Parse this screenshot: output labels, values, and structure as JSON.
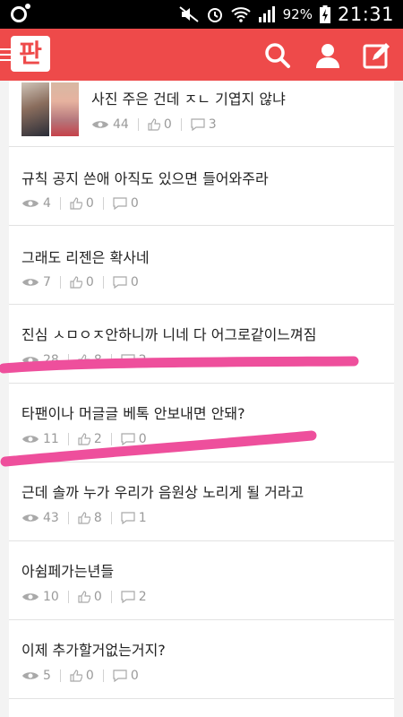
{
  "status_bar": {
    "battery": "92%",
    "time": "21:31"
  },
  "app_bar": {
    "logo_text": "판",
    "icons": [
      "menu-icon",
      "search-icon",
      "person-icon",
      "write-icon"
    ],
    "accent": "#ee4a4a"
  },
  "posts": [
    {
      "title": "사진 주은 건데 ㅈㄴ 기엽지 않냐",
      "views": "44",
      "likes": "0",
      "comments": "3",
      "has_thumb": true
    },
    {
      "title": "규칙 공지 쓴애 아직도 있으면 들어와주라",
      "views": "4",
      "likes": "0",
      "comments": "0"
    },
    {
      "title": "그래도 리젠은 확사네",
      "views": "7",
      "likes": "0",
      "comments": "0"
    },
    {
      "title": "진심 ㅅㅁㅇㅈ안하니까 니네 다 어그로같이느껴짐",
      "views": "28",
      "likes": "8",
      "comments": "2"
    },
    {
      "title": "타팬이나 머글글 베톡 안보내면 안돼?",
      "views": "11",
      "likes": "2",
      "comments": "0"
    },
    {
      "title": "근데 솔까 누가 우리가 음원상 노리게 될 거라고",
      "views": "43",
      "likes": "8",
      "comments": "1"
    },
    {
      "title": "아쉼페가는년들",
      "views": "10",
      "likes": "0",
      "comments": "2"
    },
    {
      "title": "이제 추가할거없는거지?",
      "views": "5",
      "likes": "0",
      "comments": "0"
    }
  ]
}
